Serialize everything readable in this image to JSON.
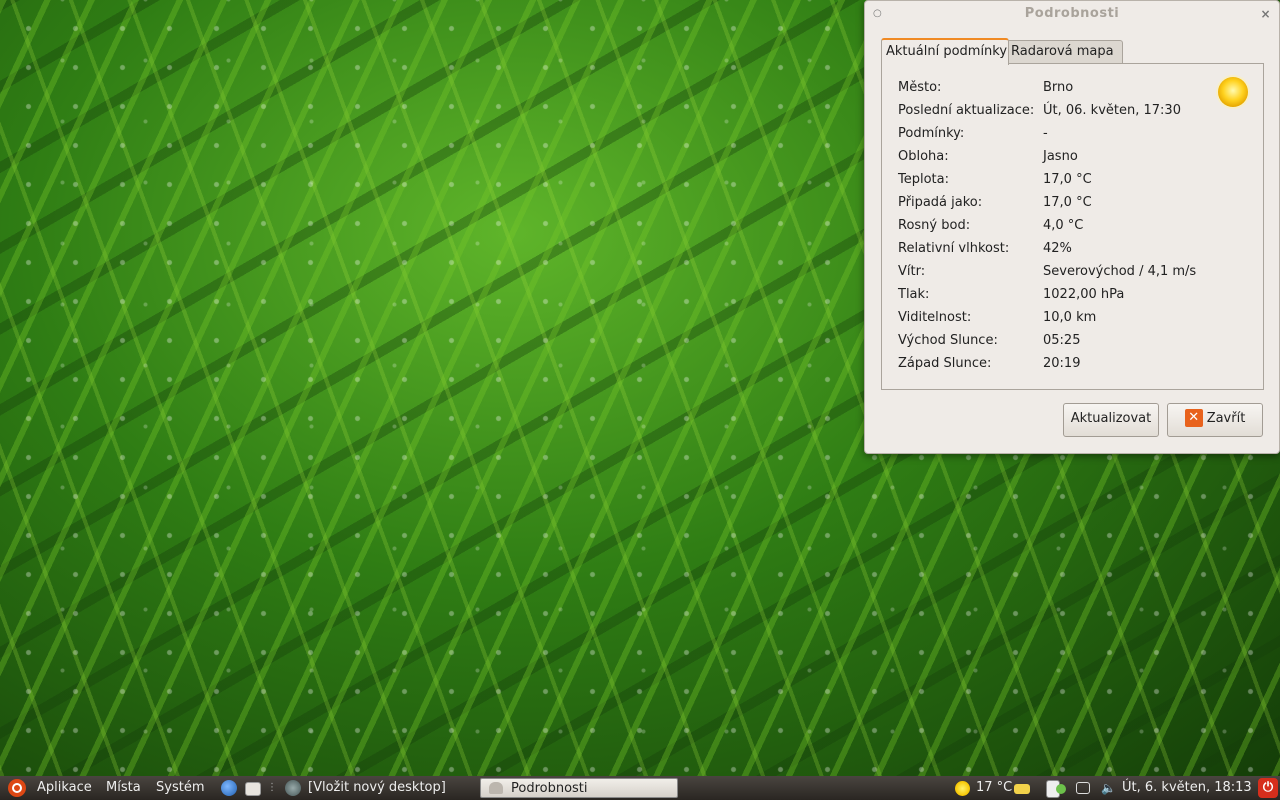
{
  "window": {
    "title": "Podrobnosti",
    "tabs": [
      {
        "label": "Aktuální podmínky",
        "active": true
      },
      {
        "label": "Radarová mapa",
        "active": false
      }
    ],
    "weather_icon": "sun-icon",
    "details": [
      {
        "label": "Město:",
        "value": "Brno"
      },
      {
        "label": "Poslední aktualizace:",
        "value": "Út, 06. květen, 17:30"
      },
      {
        "label": "Podmínky:",
        "value": "-"
      },
      {
        "label": "Obloha:",
        "value": "Jasno"
      },
      {
        "label": "Teplota:",
        "value": "17,0 °C"
      },
      {
        "label": "Připadá jako:",
        "value": "17,0 °C"
      },
      {
        "label": "Rosný bod:",
        "value": "4,0 °C"
      },
      {
        "label": "Relativní vlhkost:",
        "value": "42%"
      },
      {
        "label": "Vítr:",
        "value": "Severovýchod / 4,1 m/s"
      },
      {
        "label": "Tlak:",
        "value": "1022,00 hPa"
      },
      {
        "label": "Viditelnost:",
        "value": "10,0 km"
      },
      {
        "label": "Východ Slunce:",
        "value": "05:25"
      },
      {
        "label": "Západ Slunce:",
        "value": "20:19"
      }
    ],
    "buttons": {
      "refresh": "Aktualizovat",
      "close": "Zavřít"
    }
  },
  "taskbar": {
    "menus": [
      "Aplikace",
      "Místa",
      "Systém"
    ],
    "desktop_label": "[Vložit nový desktop]",
    "task": "Podrobnosti",
    "weather": "17 °C",
    "clock": "Út,  6. květen, 18:13"
  },
  "colors": {
    "accent_tab": "#f08a24",
    "close_icon": "#e8621c",
    "power": "#d62e1c"
  }
}
